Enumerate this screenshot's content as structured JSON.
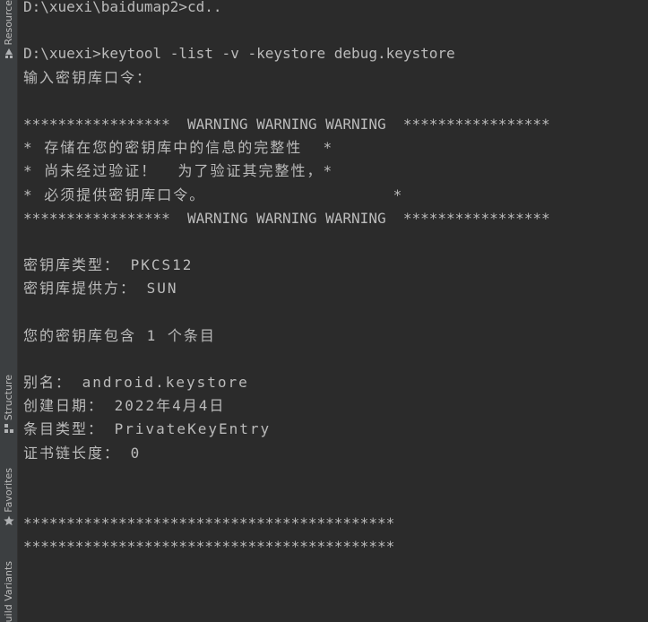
{
  "side_tabs": [
    {
      "label": "Resource",
      "icon": "resource-manager-icon"
    },
    {
      "label": "Structure",
      "icon": "structure-icon"
    },
    {
      "label": "Favorites",
      "icon": "star-icon"
    },
    {
      "label": "Build Variants",
      "icon": "build-variants-icon"
    }
  ],
  "terminal": {
    "lines": [
      "D:\\xuexi\\baidumap2>cd..",
      "",
      "D:\\xuexi>keytool -list -v -keystore debug.keystore",
      "输入密钥库口令：",
      "",
      "*****************  WARNING WARNING WARNING  *****************",
      "* 存储在您的密钥库中的信息的完整性  *",
      "* 尚未经过验证！  为了验证其完整性，*",
      "* 必须提供密钥库口令。                  *",
      "*****************  WARNING WARNING WARNING  *****************",
      "",
      "密钥库类型： PKCS12",
      "密钥库提供方： SUN",
      "",
      "您的密钥库包含 1 个条目",
      "",
      "别名： android.keystore",
      "创建日期： 2022年4月4日",
      "条目类型： PrivateKeyEntry",
      "证书链长度： 0",
      "",
      "",
      "*******************************************",
      "*******************************************"
    ]
  },
  "colors": {
    "background": "#2b2b2b",
    "text": "#bbbbbb",
    "side_strip": "#3c3f41"
  }
}
